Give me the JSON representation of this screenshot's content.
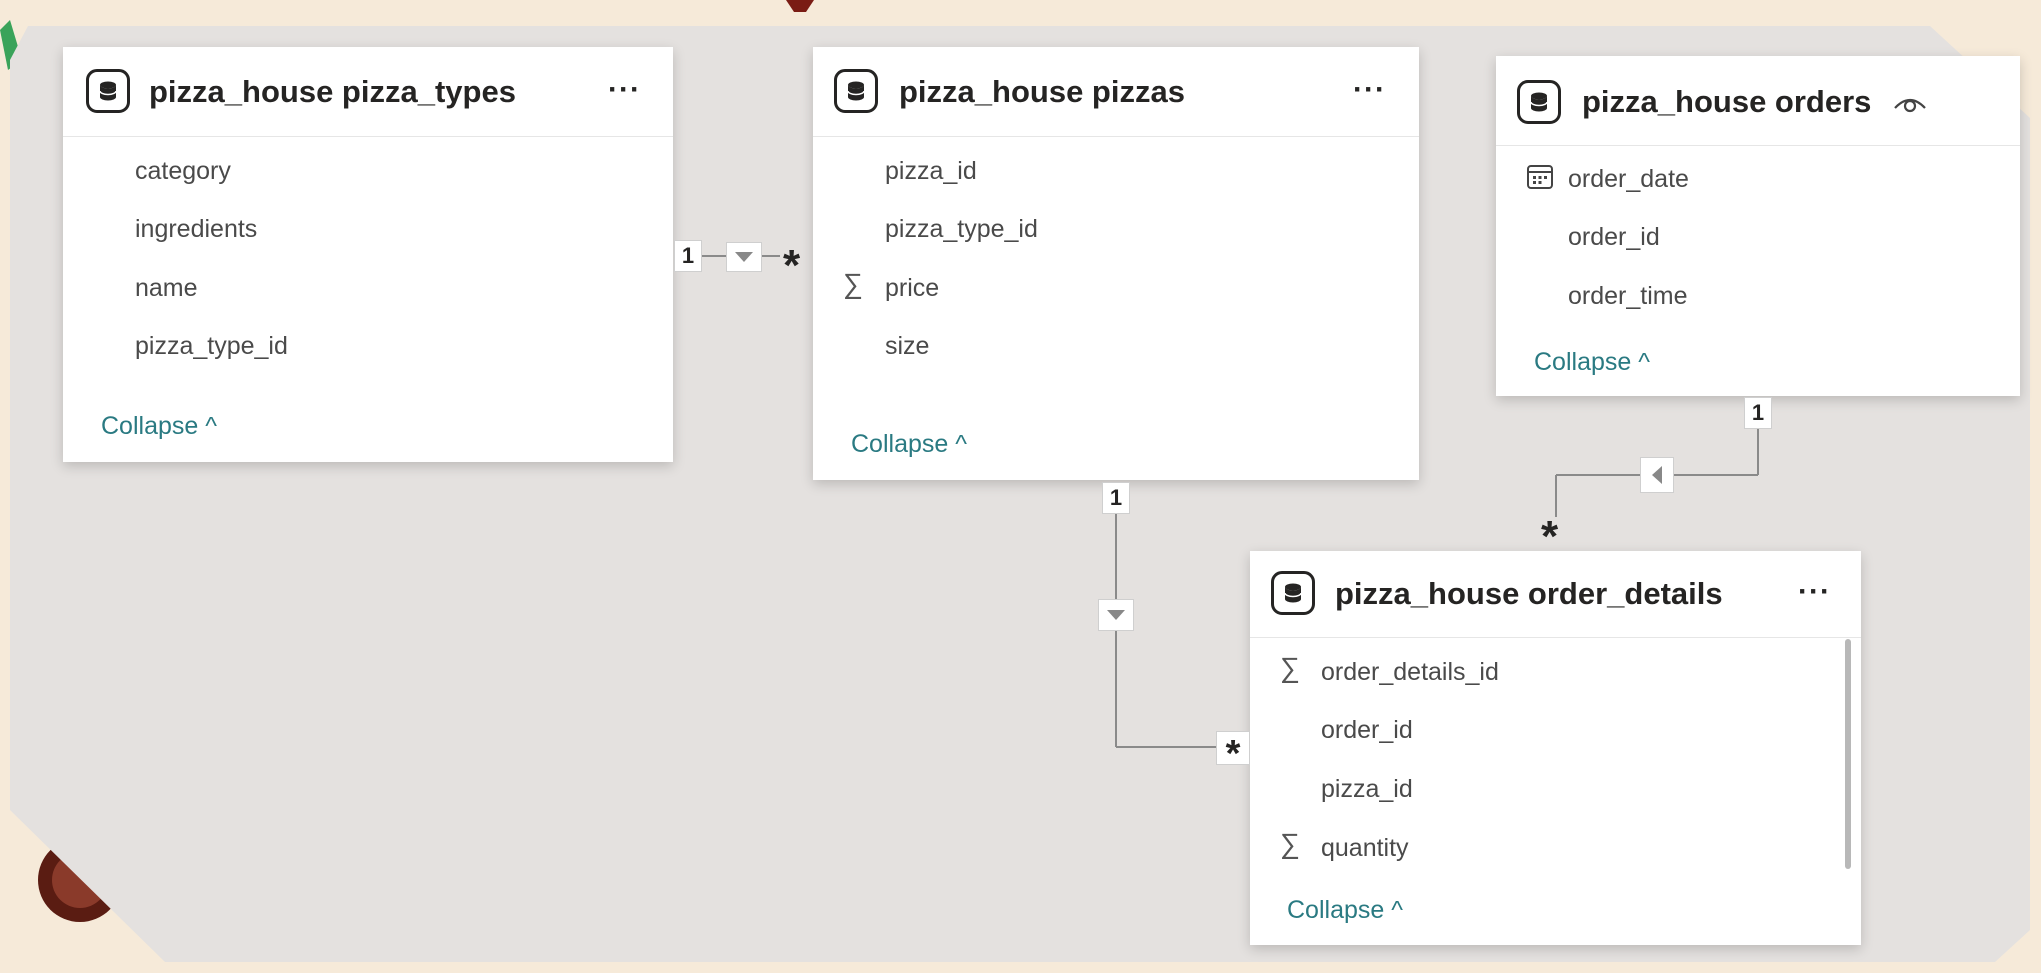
{
  "tables": [
    {
      "title": "pizza_house pizza_types",
      "fields": [
        "category",
        "ingredients",
        "name",
        "pizza_type_id"
      ],
      "collapse": "Collapse ^"
    },
    {
      "title": "pizza_house pizzas",
      "fields": [
        "pizza_id",
        "pizza_type_id",
        "price",
        "size"
      ],
      "collapse": "Collapse ^"
    },
    {
      "title": "pizza_house orders",
      "fields": [
        "order_date",
        "order_id",
        "order_time"
      ],
      "collapse": "Collapse ^"
    },
    {
      "title": "pizza_house order_details",
      "fields": [
        "order_details_id",
        "order_id",
        "pizza_id",
        "quantity"
      ],
      "collapse": "Collapse ^"
    }
  ],
  "more_label": "···",
  "relationships": {
    "one": "1",
    "many": "*",
    "sigma": "∑"
  },
  "icons": {
    "table": "database-icon",
    "measure": "sigma-icon",
    "date": "calendar-icon",
    "hidden": "eye-icon",
    "filter_direction": "triangle-icon"
  },
  "colors": {
    "canvas": "#e4e1df",
    "card": "#ffffff",
    "link": "#2a7a82",
    "text": "#252423",
    "background": "#f6ead9"
  }
}
